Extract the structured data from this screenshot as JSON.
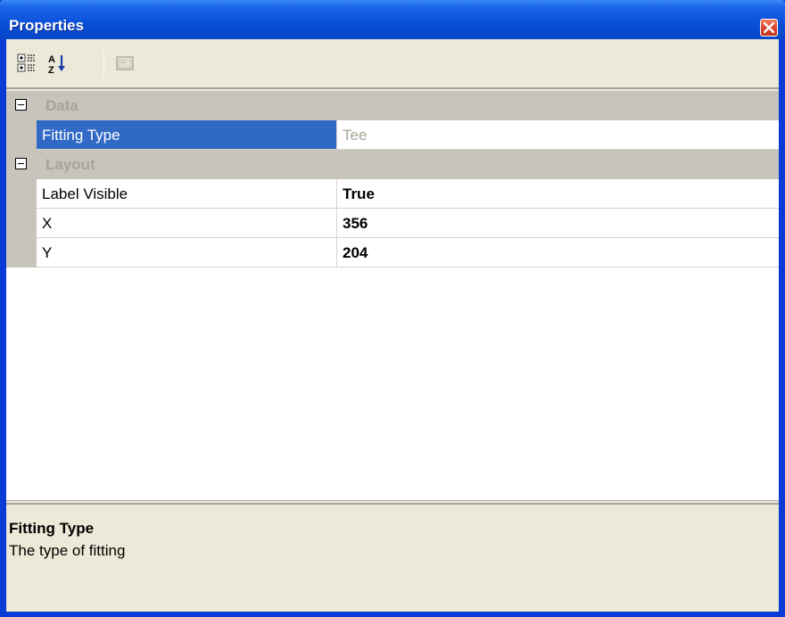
{
  "window": {
    "title": "Properties",
    "close_icon": "close-icon"
  },
  "toolbar": {
    "buttons": [
      {
        "name": "categorized-view-button",
        "icon": "categorized-icon"
      },
      {
        "name": "alphabetical-sort-button",
        "icon": "sort-az-icon"
      },
      {
        "name": "property-pages-button",
        "icon": "property-pages-icon",
        "disabled": true
      }
    ]
  },
  "grid": {
    "categories": [
      {
        "label": "Data",
        "expanded": true,
        "properties": [
          {
            "name": "Fitting Type",
            "value": "Tee",
            "selected": true,
            "readonly": true
          }
        ]
      },
      {
        "label": "Layout",
        "expanded": true,
        "properties": [
          {
            "name": "Label Visible",
            "value": "True",
            "bold": true
          },
          {
            "name": "X",
            "value": "356",
            "bold": true
          },
          {
            "name": "Y",
            "value": "204",
            "bold": true
          }
        ]
      }
    ]
  },
  "description": {
    "title": "Fitting Type",
    "text": "The type of fitting"
  },
  "colors": {
    "titlebar": "#0a4fd8",
    "selection": "#316ac5",
    "category_bg": "#c8c4bc",
    "category_text": "#a8a497",
    "face": "#ece9d8"
  }
}
